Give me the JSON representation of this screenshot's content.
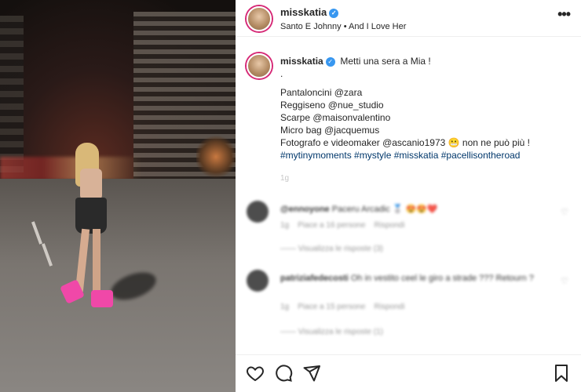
{
  "header": {
    "username": "misskatia",
    "subtitle": "Santo E Johnny • And I Love Her"
  },
  "caption": {
    "username": "misskatia",
    "lines": [
      "Metti una sera a Mia !",
      ".",
      "Pantaloncini @zara",
      "Reggiseno @nue_studio",
      "Scarpe @maisonvalentino",
      "Micro bag @jacquemus",
      "Fotografo e videomaker @ascanio1973 😬 non ne può più !",
      "#mytinymoments #mystyle #misskatia #pacellisontheroad"
    ],
    "meta": "1g"
  },
  "comments": [
    {
      "username": "@ennoyone",
      "text": "Paceru Arcadic 🥈 😍😍❤️",
      "meta_time": "1g",
      "meta_likes": "Piace a 16 persone",
      "meta_reply": "Rispondi",
      "replies": "Visualizza le risposte (3)"
    },
    {
      "username": "patriziafedecosti",
      "text": "Oh in vestito ceel le giro a strade ??? Retourn ?",
      "meta_time": "1g",
      "meta_likes": "Piace a 15 persone",
      "meta_reply": "Rispondi",
      "replies": "Visualizza le risposte (1)"
    }
  ],
  "icons": {
    "verified": "verified-badge-icon",
    "more": "more-options-icon",
    "like": "heart-icon",
    "comment": "comment-icon",
    "share": "share-icon",
    "save": "bookmark-icon"
  },
  "colors": {
    "accent_link": "#00376b",
    "verified": "#3897f0",
    "text": "#262626",
    "muted": "#8e8e8e",
    "shoes": "#f048a8"
  }
}
